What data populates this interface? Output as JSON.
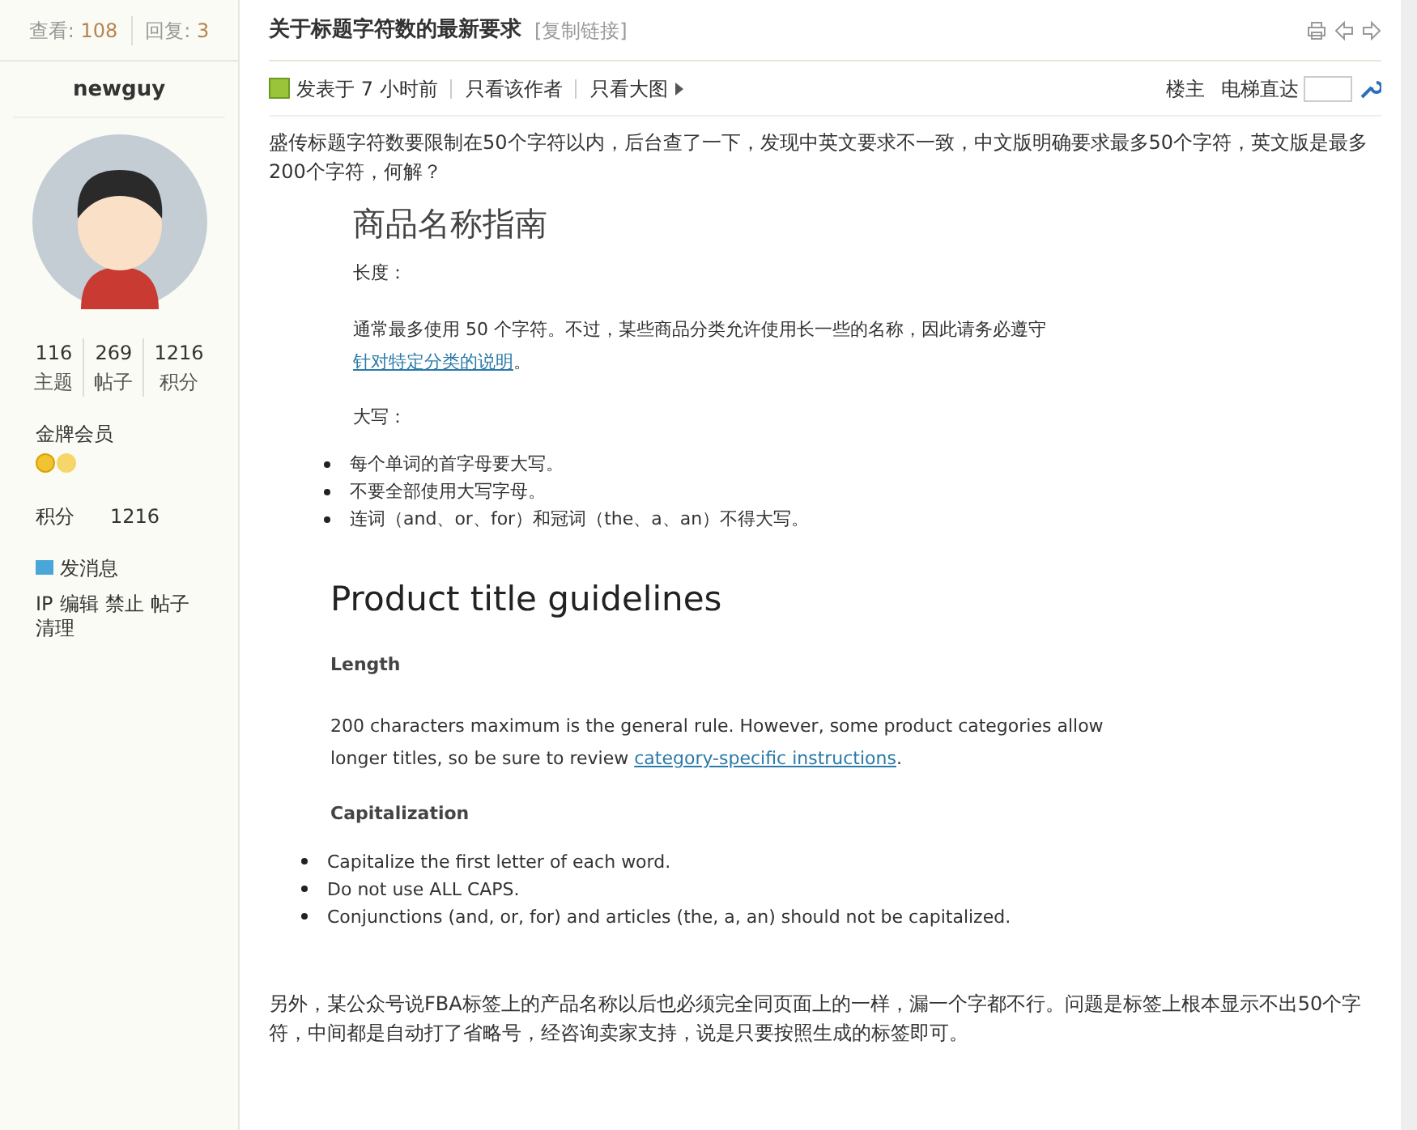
{
  "thread_stats": [
    {
      "label": "查看:",
      "value": "108"
    },
    {
      "label": "回复:",
      "value": "3"
    }
  ],
  "user": {
    "name": "newguy",
    "stats": [
      {
        "value": "116",
        "label": "主题"
      },
      {
        "value": "269",
        "label": "帖子"
      },
      {
        "value": "1216",
        "label": "积分"
      }
    ],
    "rank": "金牌会员",
    "points_label": "积分",
    "points": "1216",
    "message": "发消息",
    "admin_links": [
      "IP",
      "编辑",
      "禁止",
      "帖子",
      "清理"
    ]
  },
  "post": {
    "title": "关于标题字符数的最新要求",
    "copy_link": "[复制链接]",
    "posted": "发表于 7 小时前",
    "author_only": "只看该作者",
    "big_images": "只看大图",
    "floor": "楼主",
    "jump": "电梯直达",
    "intro": "盛传标题字符数要限制在50个字符以内，后台查了一下，发现中英文要求不一致，中文版明确要求最多50个字符，英文版是最多200个字符，何解？",
    "doc_zh": {
      "heading": "商品名称指南",
      "length_title": "长度：",
      "length_text": "通常最多使用  50  个字符。不过，某些商品分类允许使用长一些的名称，因此请务必遵守",
      "length_link": "针对特定分类的说明",
      "length_end": "。",
      "caps_title": "大写：",
      "bullets": [
        "每个单词的首字母要大写。",
        "不要全部使用大写字母。",
        "连词（and、or、for）和冠词（the、a、an）不得大写。"
      ]
    },
    "doc_en": {
      "heading": "Product title guidelines",
      "length_title": "Length",
      "length_text": "200 characters maximum is the general rule. However, some product categories allow longer titles, so be sure to review ",
      "length_link": "category-specific instructions",
      "length_end": ".",
      "caps_title": "Capitalization",
      "bullets": [
        "Capitalize the first letter of each word.",
        "Do not use ALL CAPS.",
        "Conjunctions (and, or, for) and articles (the, a, an) should not be capitalized."
      ]
    },
    "outro": "另外，某公众号说FBA标签上的产品名称以后也必须完全同页面上的一样，漏一个字都不行。问题是标签上根本显示不出50个字符，中间都是自动打了省略号，经咨询卖家支持，说是只要按照生成的标签即可。"
  }
}
